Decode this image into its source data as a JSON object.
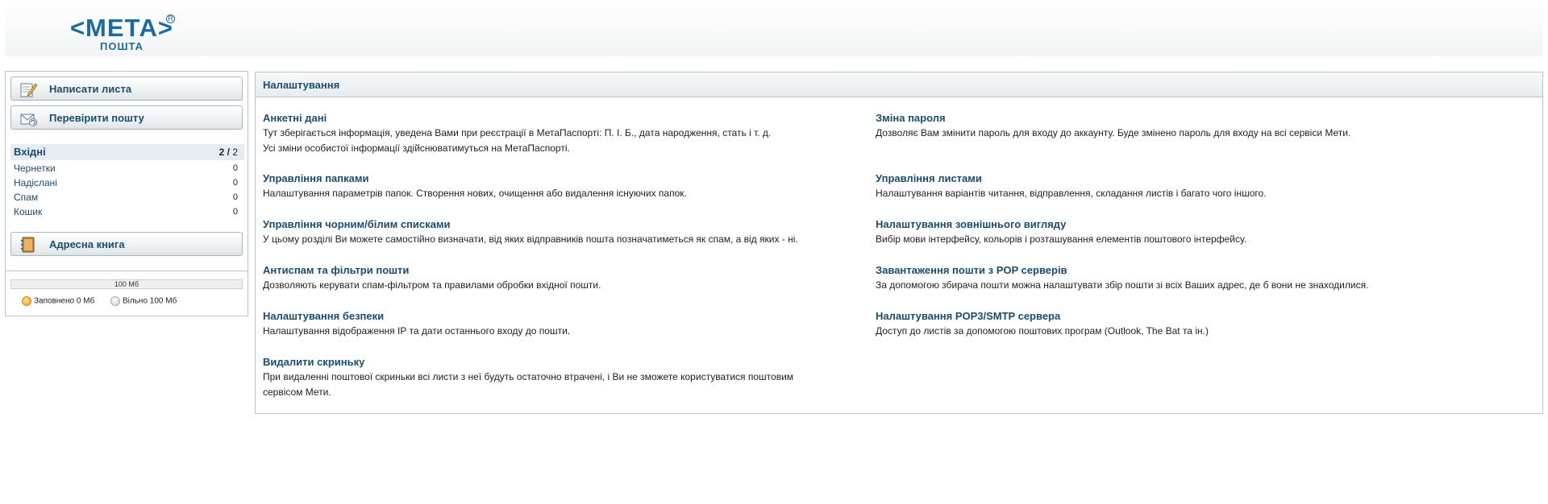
{
  "logo": {
    "meta": "<МЕТА>",
    "pochta": "ПОШТА",
    "reg": "R"
  },
  "sidebar": {
    "compose_label": "Написати листа",
    "check_label": "Перевірити пошту",
    "address_book_label": "Адресна книга",
    "folders": [
      {
        "name": "Вхідні",
        "unread": "2",
        "total": "2"
      },
      {
        "name": "Чернетки",
        "count": "0"
      },
      {
        "name": "Надіслані",
        "count": "0"
      },
      {
        "name": "Спам",
        "count": "0"
      },
      {
        "name": "Кошик",
        "count": "0"
      }
    ]
  },
  "quota": {
    "bar_text": "100 Мб",
    "used_fraction": 0,
    "used_label": "Заповнено 0 Мб",
    "free_label": "Вільно 100 Мб"
  },
  "main": {
    "title": "Налаштування",
    "settings": [
      {
        "title": "Анкетні дані",
        "desc": "Тут зберігається інформація, уведена Вами при реєстрації в МетаПаспорті: П. І. Б., дата народження, стать і т. д.",
        "desc2": "Усі зміни особистої інформації здійснюватимуться на МетаПаспорті."
      },
      {
        "title": "Зміна пароля",
        "desc": "Дозволяє Вам змінити пароль для входу до аккаунту. Буде змінено пароль для входу на всі сервіси Мети."
      },
      {
        "title": "Управління папками",
        "desc": "Налаштування параметрів папок. Створення нових, очищення або видалення існуючих папок."
      },
      {
        "title": "Управління листами",
        "desc": "Налаштування варіантів читання, відправлення, складання листів і багато чого іншого."
      },
      {
        "title": "Управління чорним/білим списками",
        "desc": "У цьому розділі Ви можете самостійно визначати, від яких відправників пошта позначатиметься як спам, а від яких - ні."
      },
      {
        "title": "Налаштування зовнішнього вигляду",
        "desc": "Вибір мови інтерфейсу, кольорів і розташування елементів поштового інтерфейсу."
      },
      {
        "title": "Антиспам та фільтри пошти",
        "desc": "Дозволяють керувати спам-фільтром та правилами обробки вхідної пошти."
      },
      {
        "title": "Завантаження пошти з POP серверів",
        "desc": "За допомогою збирача пошти можна налаштувати збір пошти зі всіх Ваших адрес, де б вони не знаходилися."
      },
      {
        "title": "Налаштування безпеки",
        "desc": "Налаштування відображення IP та дати останнього входу до пошти."
      },
      {
        "title": "Налаштування POP3/SMTP сервера",
        "desc": "Доступ до листів за допомогою поштових програм (Outlook, The Bat та ін.)"
      },
      {
        "title": "Видалити скриньку",
        "desc": "При видаленні поштової скриньки всі листи з неї будуть остаточно втрачені, і Ви не зможете користуватися поштовим",
        "desc2": "сервісом Мети."
      }
    ]
  },
  "icons": {
    "compose": "pencil-paper-icon",
    "check": "mail-check-icon",
    "address_book": "address-book-icon"
  }
}
